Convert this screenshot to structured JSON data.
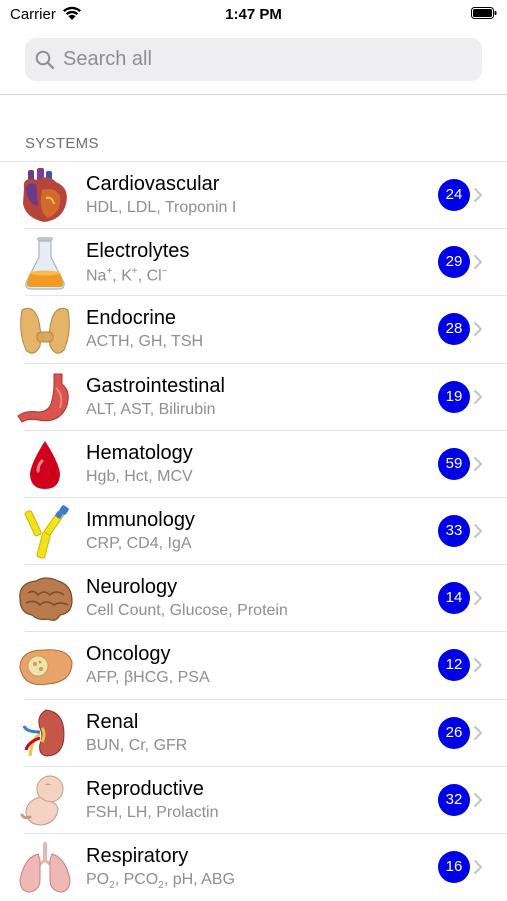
{
  "status_bar": {
    "carrier": "Carrier",
    "time": "1:47 PM"
  },
  "search": {
    "placeholder": "Search all"
  },
  "section": {
    "title": "SYSTEMS"
  },
  "colors": {
    "badge": "#0000e6",
    "subtitle": "#8e8e93",
    "separator": "#e3e3e6"
  },
  "items": [
    {
      "title": "Cardiovascular",
      "subtitle": "HDL, LDL, Troponin I",
      "count": "24",
      "icon": "heart-icon"
    },
    {
      "title": "Electrolytes",
      "subtitle_parts": {
        "a": "Na",
        "a_sup": "+",
        "b": ", K",
        "b_sup": "+",
        "c": ", Cl",
        "c_sup": "−"
      },
      "count": "29",
      "icon": "flask-icon"
    },
    {
      "title": "Endocrine",
      "subtitle": "ACTH, GH, TSH",
      "count": "28",
      "icon": "thyroid-icon"
    },
    {
      "title": "Gastrointestinal",
      "subtitle": "ALT, AST, Bilirubin",
      "count": "19",
      "icon": "stomach-icon"
    },
    {
      "title": "Hematology",
      "subtitle": "Hgb, Hct, MCV",
      "count": "59",
      "icon": "blood-drop-icon"
    },
    {
      "title": "Immunology",
      "subtitle": "CRP, CD4, IgA",
      "count": "33",
      "icon": "antibody-icon"
    },
    {
      "title": "Neurology",
      "subtitle": "Cell Count, Glucose, Protein",
      "count": "14",
      "icon": "brain-icon"
    },
    {
      "title": "Oncology",
      "subtitle": "AFP, βHCG, PSA",
      "count": "12",
      "icon": "tumor-icon"
    },
    {
      "title": "Renal",
      "subtitle": "BUN, Cr, GFR",
      "count": "26",
      "icon": "kidney-icon"
    },
    {
      "title": "Reproductive",
      "subtitle": "FSH, LH, Prolactin",
      "count": "32",
      "icon": "fetus-icon"
    },
    {
      "title": "Respiratory",
      "subtitle_parts": {
        "a": "PO",
        "a_sub": "2",
        "b": ", PCO",
        "b_sub": "2",
        "c": ", pH, ABG"
      },
      "count": "16",
      "icon": "lungs-icon"
    }
  ]
}
